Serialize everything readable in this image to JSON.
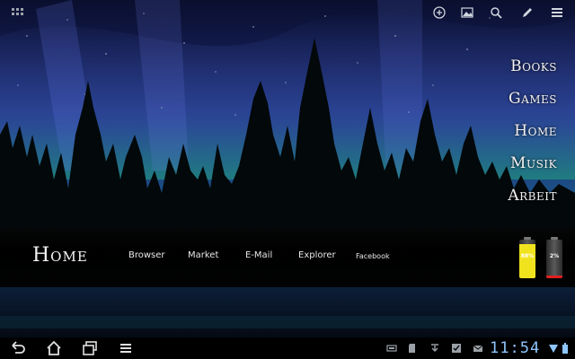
{
  "side_menu": {
    "items": [
      {
        "label": "Books"
      },
      {
        "label": "Games"
      },
      {
        "label": "Home"
      },
      {
        "label": "Musik"
      },
      {
        "label": "Arbeit"
      }
    ]
  },
  "dock": {
    "title": "Home",
    "links": [
      {
        "label": "Browser"
      },
      {
        "label": "Market"
      },
      {
        "label": "E-Mail"
      },
      {
        "label": "Explorer"
      },
      {
        "label": "Facebook"
      }
    ]
  },
  "batteries": [
    {
      "label": "88%",
      "level": 0.88,
      "color": "#f1e21e"
    },
    {
      "label": "2%",
      "level": 0.06,
      "color": "#e02020"
    }
  ],
  "status_bar": {
    "time": "11:54"
  },
  "colors": {
    "clock": "#8fc6ff",
    "aurora_green": "#1aa06a",
    "sky_blue": "#2a3f9a"
  },
  "icons": {
    "top_left": "app-grid-icon",
    "top_right": [
      "add-widget-icon",
      "wallpaper-icon",
      "search-icon",
      "edit-icon",
      "menu-icon"
    ],
    "nav": [
      "back-icon",
      "home-icon",
      "recent-apps-icon",
      "menu-icon"
    ],
    "status": [
      "usb-icon",
      "sd-card-icon",
      "download-icon",
      "checkbox-icon",
      "gmail-icon",
      "wifi-icon",
      "battery-icon"
    ]
  }
}
